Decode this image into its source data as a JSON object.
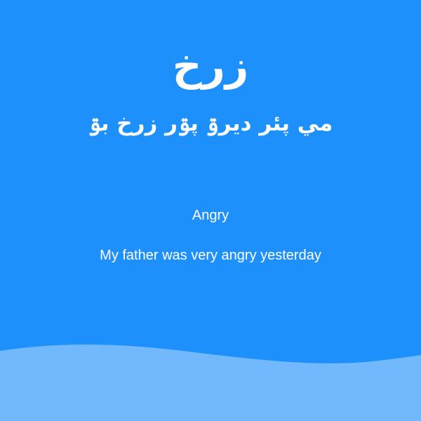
{
  "card": {
    "word": "زرخ",
    "sentence": "مي پئر ديرۊ پۊر زرخ بۊ",
    "translation_word": "Angry",
    "translation_sentence": "My father was very angry yesterday"
  },
  "colors": {
    "background": "#1e90fc",
    "wave": "#72b8fd",
    "text": "#ffffff"
  }
}
